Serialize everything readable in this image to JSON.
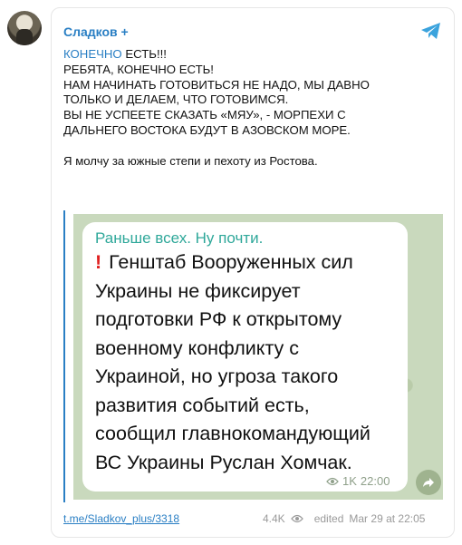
{
  "channel": {
    "name": "Сладков +"
  },
  "post": {
    "lines": [
      {
        "link": "КОНЕЧНО",
        "text": " ЕСТЬ!!!"
      },
      {
        "text": "РЕБЯТА, КОНЕЧНО ЕСТЬ!"
      },
      {
        "text": "НАМ НАЧИНАТЬ ГОТОВИТЬСЯ НЕ НАДО, МЫ ДАВНО"
      },
      {
        "text": "ТОЛЬКО И ДЕЛАЕМ, ЧТО ГОТОВИМСЯ."
      },
      {
        "text": "ВЫ НЕ УСПЕЕТЕ СКАЗАТЬ «МЯУ», - МОРПЕХИ С"
      },
      {
        "text": "ДАЛЬНЕГО ВОСТОКА БУДУТ В АЗОВСКОМ МОРЕ."
      },
      {
        "text": ""
      },
      {
        "text": "Я молчу за южные степи и пехоту из Ростова."
      }
    ]
  },
  "forward": {
    "title": "Раньше всех. Ну почти.",
    "lines": [
      "Генштаб Вооруженных сил",
      "Украины не фиксирует",
      "подготовки РФ к открытому",
      "военному конфликту с",
      "Украиной, но угроза такого",
      "развития событий есть,",
      "сообщил главнокомандующий",
      "ВС Украины Руслан Хомчак."
    ],
    "views": "1K",
    "time": "22:00"
  },
  "footer": {
    "link": "t.me/Sladkov_plus/3318",
    "views": "4.4K",
    "edited": "edited",
    "date": "Mar 29 at 22:05"
  },
  "colors": {
    "accent": "#2a7fc4",
    "forward_title": "#2fa89a",
    "alert": "#e02020"
  },
  "icons": [
    "telegram-icon",
    "eye-icon",
    "share-icon"
  ]
}
